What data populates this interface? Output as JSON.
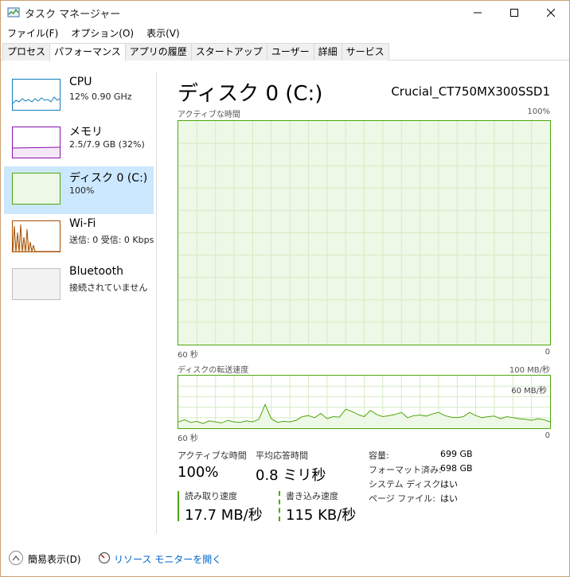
{
  "window": {
    "title": "タスク マネージャー"
  },
  "menu": [
    "ファイル(F)",
    "オプション(O)",
    "表示(V)"
  ],
  "tabs": [
    "プロセス",
    "パフォーマンス",
    "アプリの履歴",
    "スタートアップ",
    "ユーザー",
    "詳細",
    "サービス"
  ],
  "active_tab": "パフォーマンス",
  "sidebar": {
    "items": [
      {
        "name": "CPU",
        "sub": "12%  0.90 GHz",
        "color": "#117dbb"
      },
      {
        "name": "メモリ",
        "sub": "2.5/7.9 GB (32%)",
        "color": "#8b12ae"
      },
      {
        "name": "ディスク 0 (C:)",
        "sub": "100%",
        "color": "#4da60c"
      },
      {
        "name": "Wi-Fi",
        "sub": "送信: 0  受信: 0 Kbps",
        "color": "#a74f01"
      },
      {
        "name": "Bluetooth",
        "sub": "接続されていません",
        "color": "#c0c0c0"
      }
    ],
    "selected": "ディスク 0 (C:)"
  },
  "main": {
    "title": "ディスク 0 (C:)",
    "device": "Crucial_CT750MX300SSD1",
    "active_time_chart": {
      "label": "アクティブな時間",
      "max": "100%",
      "x_left": "60 秒",
      "x_right": "0",
      "value_percent": 100
    },
    "transfer_chart": {
      "label": "ディスクの転送速度",
      "max": "100 MB/秒",
      "mid_label": "60 MB/秒",
      "x_left": "60 秒",
      "x_right": "0",
      "unit": "MB/秒",
      "y_max": 100,
      "values": [
        12,
        16,
        11,
        13,
        9,
        14,
        12,
        10,
        15,
        12,
        11,
        14,
        12,
        17,
        45,
        18,
        11,
        13,
        12,
        15,
        22,
        24,
        20,
        28,
        18,
        22,
        21,
        36,
        32,
        26,
        22,
        34,
        26,
        22,
        24,
        26,
        30,
        20,
        24,
        25,
        23,
        27,
        30,
        24,
        21,
        20,
        22,
        30,
        24,
        20,
        22,
        23,
        18,
        22,
        20,
        18,
        17,
        15,
        18,
        16,
        12
      ]
    },
    "stats": {
      "active_label": "アクティブな時間",
      "active_value": "100%",
      "response_label": "平均応答時間",
      "response_value": "0.8 ミリ秒",
      "read_label": "読み取り速度",
      "read_value": "17.7 MB/秒",
      "write_label": "書き込み速度",
      "write_value": "115 KB/秒"
    },
    "details": [
      {
        "key": "容量:",
        "value": "699 GB"
      },
      {
        "key": "フォーマット済み:",
        "value": "698 GB"
      },
      {
        "key": "システム ディスク:",
        "value": "はい"
      },
      {
        "key": "ページ ファイル:",
        "value": "はい"
      }
    ]
  },
  "footer": {
    "fewer_details": "簡易表示(D)",
    "resource_monitor": "リソース モニターを開く"
  },
  "colors": {
    "disk_green": "#4da60c",
    "selected_bg": "#cce8ff",
    "link": "#0066cc"
  }
}
